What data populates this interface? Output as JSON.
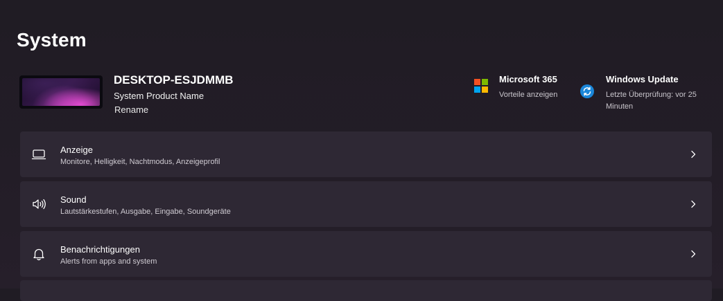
{
  "page": {
    "title": "System"
  },
  "device": {
    "name": "DESKTOP-ESJDMMB",
    "model": "System Product Name",
    "rename_label": "Rename"
  },
  "promos": {
    "m365": {
      "title": "Microsoft 365",
      "subtitle": "Vorteile anzeigen",
      "icon": "microsoft-logo",
      "colors": [
        "#f25022",
        "#7fba00",
        "#00a4ef",
        "#ffb900"
      ]
    },
    "windows_update": {
      "title": "Windows Update",
      "subtitle": "Letzte Überprüfung: vor 25 Minuten",
      "icon": "sync-icon",
      "color": "#1a86d9"
    }
  },
  "settings": [
    {
      "title": "Anzeige",
      "subtitle": "Monitore, Helligkeit, Nachtmodus, Anzeigeprofil",
      "icon": "display-icon"
    },
    {
      "title": "Sound",
      "subtitle": "Lautstärkestufen, Ausgabe, Eingabe, Soundgeräte",
      "icon": "speaker-icon"
    },
    {
      "title": "Benachrichtigungen",
      "subtitle": "Alerts from apps and system",
      "icon": "bell-icon"
    }
  ],
  "theme": {
    "background": "#211c25",
    "card": "#2e2834",
    "accent": "#1a86d9"
  }
}
